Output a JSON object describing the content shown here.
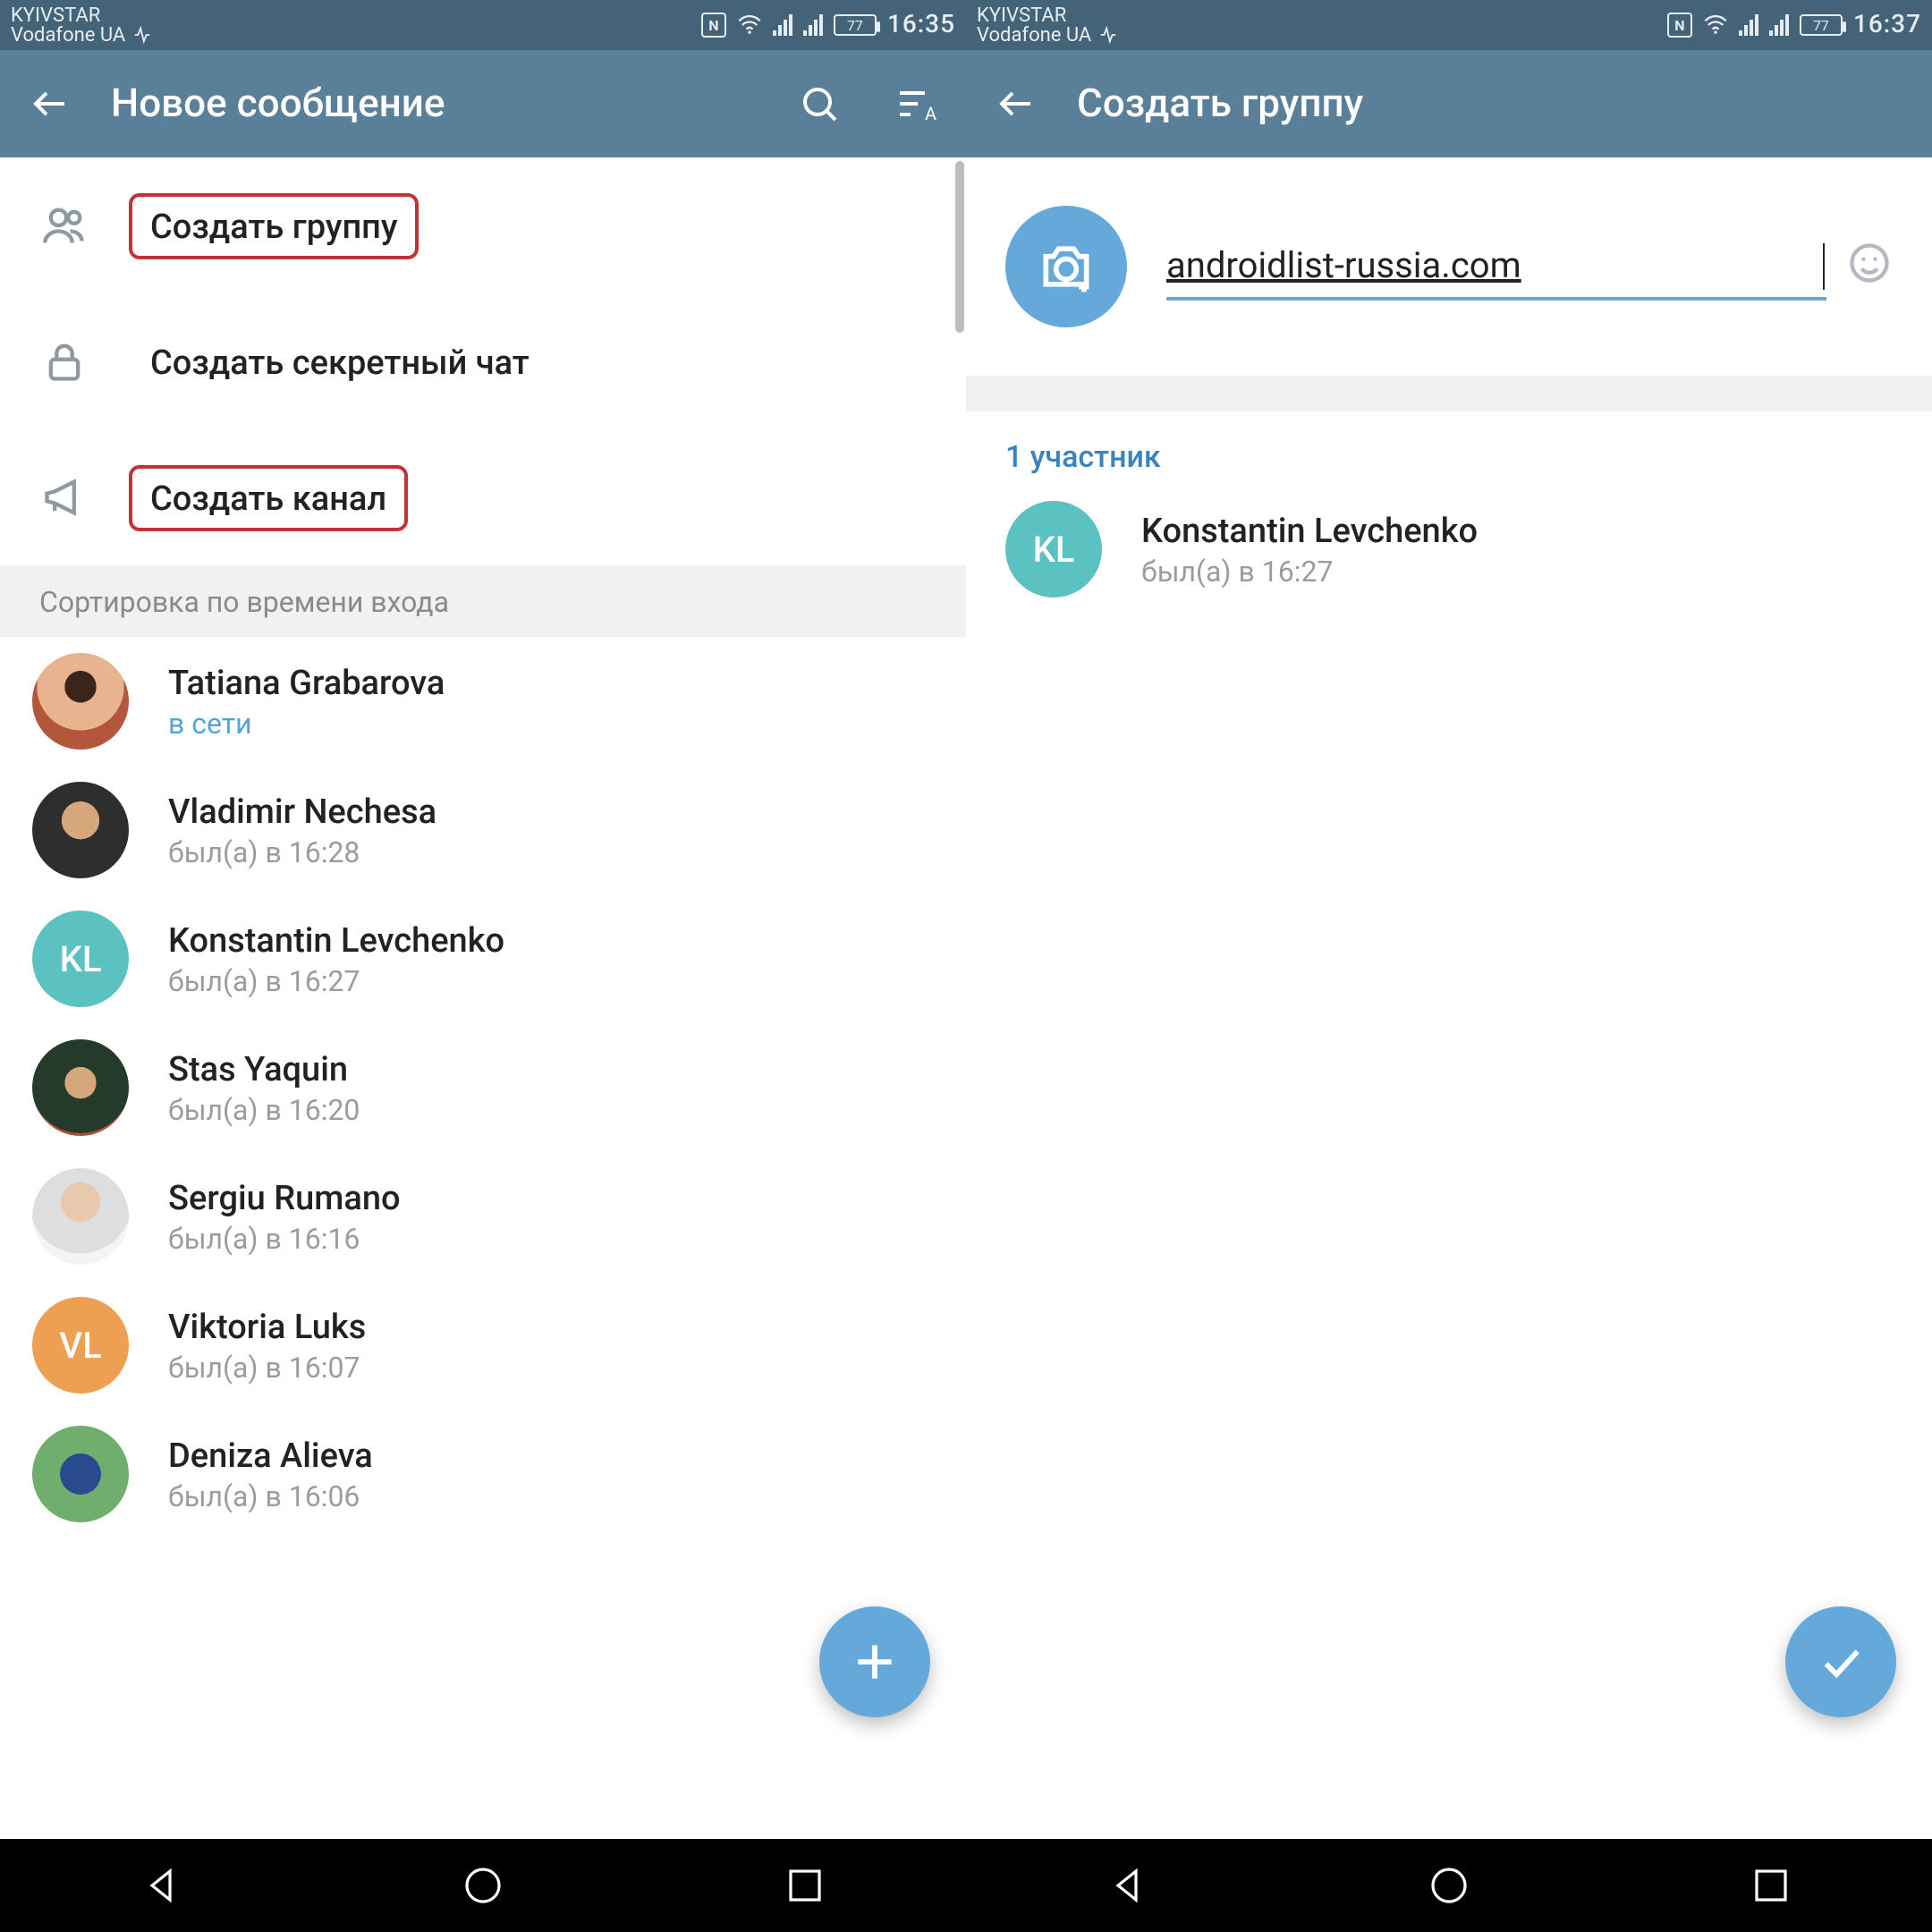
{
  "phone1": {
    "status": {
      "carrier1": "KYIVSTAR",
      "carrier2": "Vodafone UA",
      "battery": "77",
      "time": "16:35"
    },
    "appbar": {
      "title": "Новое сообщение"
    },
    "actions": {
      "create_group": "Создать группу",
      "create_secret": "Создать секретный чат",
      "create_channel": "Создать канал"
    },
    "sort_label": "Сортировка по времени входа",
    "contacts": [
      {
        "name": "Tatiana Grabarova",
        "status": "в сети",
        "online": true,
        "initials": "",
        "avatar_class": "av1 img"
      },
      {
        "name": "Vladimir Nechesa",
        "status": "был(а) в 16:28",
        "online": false,
        "initials": "",
        "avatar_class": "av2 img"
      },
      {
        "name": "Konstantin Levchenko",
        "status": "был(а) в 16:27",
        "online": false,
        "initials": "KL",
        "avatar_class": "av-teal"
      },
      {
        "name": "Stas Yaquin",
        "status": "был(а) в 16:20",
        "online": false,
        "initials": "",
        "avatar_class": "av4 img"
      },
      {
        "name": "Sergiu Rumano",
        "status": "был(а) в 16:16",
        "online": false,
        "initials": "",
        "avatar_class": "av5 img"
      },
      {
        "name": "Viktoria Luks",
        "status": "был(а) в 16:07",
        "online": false,
        "initials": "VL",
        "avatar_class": "av-orange"
      },
      {
        "name": "Deniza Alieva",
        "status": "был(а) в 16:06",
        "online": false,
        "initials": "",
        "avatar_class": "av7 img"
      }
    ]
  },
  "phone2": {
    "status": {
      "carrier1": "KYIVSTAR",
      "carrier2": "Vodafone UA",
      "battery": "77",
      "time": "16:37"
    },
    "appbar": {
      "title": "Создать группу"
    },
    "group_name": "androidlist-russia.com",
    "members_label": "1 участник",
    "members": [
      {
        "name": "Konstantin Levchenko",
        "status": "был(а) в 16:27",
        "initials": "KL",
        "avatar_class": "av-teal"
      }
    ]
  }
}
